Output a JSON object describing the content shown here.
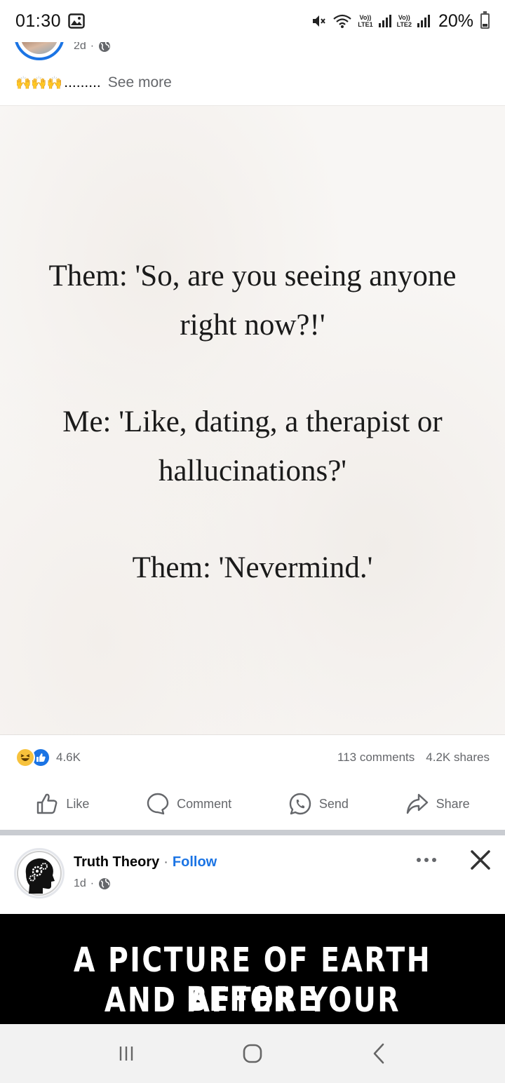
{
  "status_bar": {
    "time": "01:30",
    "lte1_top": "Vo))",
    "lte1_bottom": "LTE1",
    "lte2_top": "Vo))",
    "lte2_bottom": "LTE2",
    "battery": "20%",
    "battery_level": 0.2
  },
  "post1": {
    "time_ago": "2d",
    "dot": "·",
    "caption_emoji": "🙌🙌🙌",
    "caption_dots": ".........",
    "see_more": "See more",
    "quote_lines": [
      "Them: 'So, are you seeing anyone",
      "right now?!'",
      "Me: 'Like, dating, a therapist or",
      "hallucinations?'",
      "Them: 'Nevermind.'"
    ],
    "reactions_count": "4.6K",
    "comments": "113 comments",
    "shares": "4.2K shares",
    "actions": {
      "like": "Like",
      "comment": "Comment",
      "send": "Send",
      "share": "Share"
    }
  },
  "post2": {
    "page_name": "Truth Theory",
    "dot": "·",
    "follow": "Follow",
    "time_ago": "1d",
    "banner_lines": [
      "A PICTURE OF EARTH BEFORE",
      "AND AFTER YOUR OPINION"
    ]
  },
  "colors": {
    "accent": "#1b74e4",
    "secondary_text": "#65676b",
    "separator": "#c9ccd1"
  },
  "icons": [
    "gallery-icon",
    "mute-icon",
    "wifi-icon",
    "globe-icon",
    "like-icon",
    "comment-icon",
    "send-icon",
    "share-icon",
    "more-icon",
    "close-icon",
    "recents-icon",
    "home-icon",
    "back-icon"
  ]
}
